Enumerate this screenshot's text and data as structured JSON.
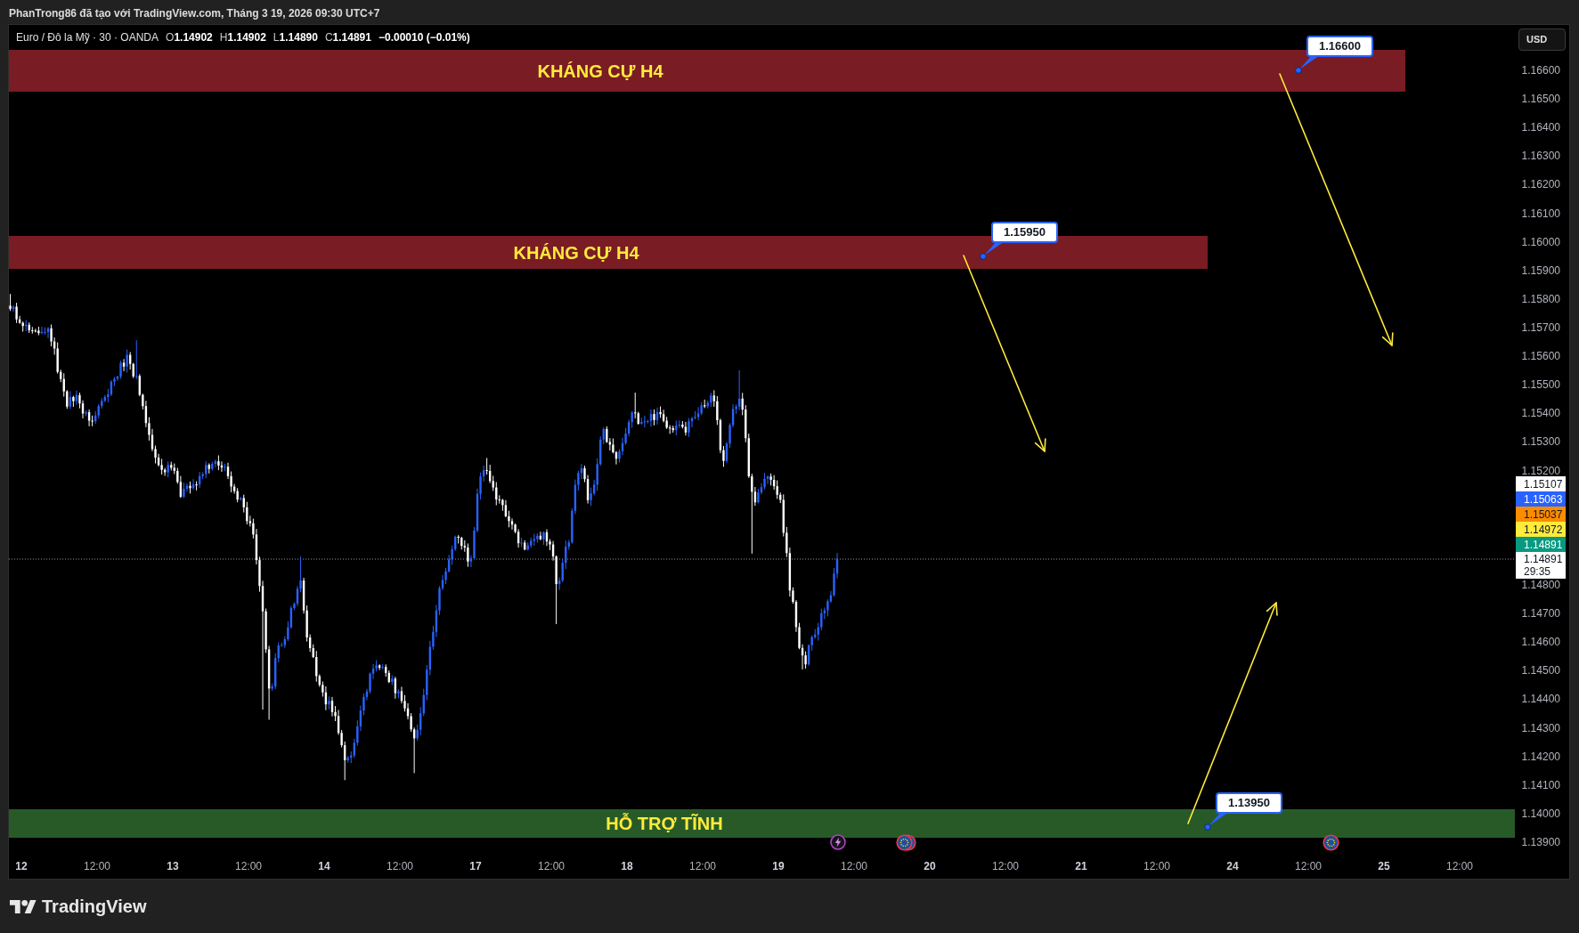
{
  "header": {
    "caption": "PhanTrong86 đã tạo với TradingView.com, Tháng 3 19, 2026 09:30 UTC+7"
  },
  "legend": {
    "symbol": "Euro / Đô la Mỹ · 30 · OANDA",
    "ohlc": [
      {
        "label": "O",
        "value": "1.14902"
      },
      {
        "label": "H",
        "value": "1.14902"
      },
      {
        "label": "L",
        "value": "1.14890"
      },
      {
        "label": "C",
        "value": "1.14891"
      }
    ],
    "change": "−0.00010 (−0.01%)"
  },
  "zones": [
    {
      "label": "KHÁNG CỰ H4",
      "color": "#7a1c24"
    },
    {
      "label": "KHÁNG CỰ H4",
      "color": "#7a1c24"
    },
    {
      "label": "HỖ TRỢ TĨNH",
      "color": "#285a28"
    }
  ],
  "callouts": [
    {
      "text": "1.16600"
    },
    {
      "text": "1.15950"
    },
    {
      "text": "1.13950"
    }
  ],
  "price_axis": {
    "currency": "USD",
    "upper_ticks": [
      "1.16600",
      "1.16500",
      "1.16400",
      "1.16300",
      "1.16200",
      "1.16100",
      "1.16000",
      "1.15900",
      "1.15800",
      "1.15700",
      "1.15600",
      "1.15500",
      "1.15400",
      "1.15300",
      "1.15200"
    ],
    "lower_ticks": [
      "1.14800",
      "1.14700",
      "1.14600",
      "1.14500",
      "1.14400",
      "1.14300",
      "1.14200",
      "1.14100",
      "1.14000",
      "1.13900"
    ]
  },
  "price_tags": [
    {
      "price": "1.15107",
      "color": "#ffffff"
    },
    {
      "price": "1.15063",
      "color": "#2962ff"
    },
    {
      "price": "1.15037",
      "color": "#fb8c00"
    },
    {
      "price": "1.14972",
      "color": "#ffeb3b"
    },
    {
      "price": "1.14891",
      "color": "#089981"
    },
    {
      "price": "1.14891",
      "countdown": "29:35",
      "color": "#ffffff"
    }
  ],
  "time_axis": [
    {
      "kind": "day",
      "label": "12"
    },
    {
      "kind": "time",
      "label": "12:00"
    },
    {
      "kind": "day",
      "label": "13"
    },
    {
      "kind": "time",
      "label": "12:00"
    },
    {
      "kind": "day",
      "label": "14"
    },
    {
      "kind": "time",
      "label": "12:00"
    },
    {
      "kind": "day",
      "label": "17"
    },
    {
      "kind": "time",
      "label": "12:00"
    },
    {
      "kind": "day",
      "label": "18"
    },
    {
      "kind": "time",
      "label": "12:00"
    },
    {
      "kind": "day",
      "label": "19"
    },
    {
      "kind": "time",
      "label": "12:00"
    },
    {
      "kind": "day",
      "label": "20"
    },
    {
      "kind": "time",
      "label": "12:00"
    },
    {
      "kind": "day",
      "label": "21"
    },
    {
      "kind": "time",
      "label": "12:00"
    },
    {
      "kind": "day",
      "label": "24"
    },
    {
      "kind": "time",
      "label": "12:00"
    },
    {
      "kind": "day",
      "label": "25"
    },
    {
      "kind": "time",
      "label": "12:00"
    }
  ],
  "branding": {
    "name": "TradingView"
  }
}
